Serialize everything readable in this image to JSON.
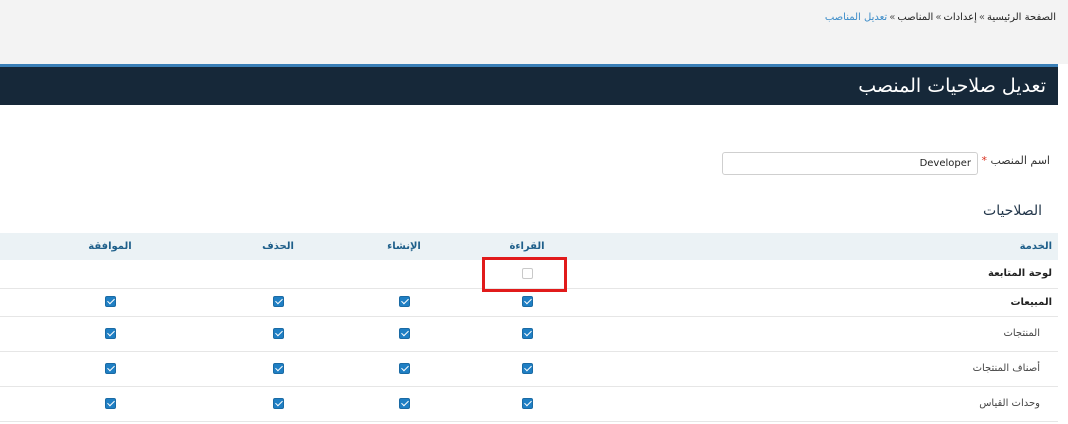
{
  "breadcrumb": [
    "الصفحة الرئيسية",
    "إعدادات",
    "المناصب",
    "تعديل المناصب"
  ],
  "breadcrumb_separator": "»",
  "panel": {
    "title": "تعديل صلاحيات المنصب"
  },
  "form": {
    "position_name_label": "اسم المنصب",
    "required_marker": "*",
    "position_name_value": "Developer"
  },
  "permissions": {
    "section_title": "الصلاحيات",
    "columns": {
      "service": "الخدمة",
      "read": "القراءة",
      "create": "الإنشاء",
      "delete": "الحذف",
      "approve": "الموافقة"
    },
    "rows": [
      {
        "label": "لوحة المتابعة",
        "type": "group",
        "read": false,
        "create": null,
        "delete": null,
        "approve": null
      },
      {
        "label": "المبيعات",
        "type": "group",
        "read": true,
        "create": true,
        "delete": true,
        "approve": true
      },
      {
        "label": "المنتجات",
        "type": "child",
        "read": true,
        "create": true,
        "delete": true,
        "approve": true
      },
      {
        "label": "أصناف المنتجات",
        "type": "child",
        "read": true,
        "create": true,
        "delete": true,
        "approve": true
      },
      {
        "label": "وحدات القياس",
        "type": "child",
        "read": true,
        "create": true,
        "delete": true,
        "approve": true
      }
    ]
  },
  "colors": {
    "header_bg": "#162839",
    "header_border": "#3a7fb7",
    "table_header_bg": "#ebf2f5",
    "checkbox_checked": "#1f7fc4",
    "highlight": "#e11b1b"
  }
}
